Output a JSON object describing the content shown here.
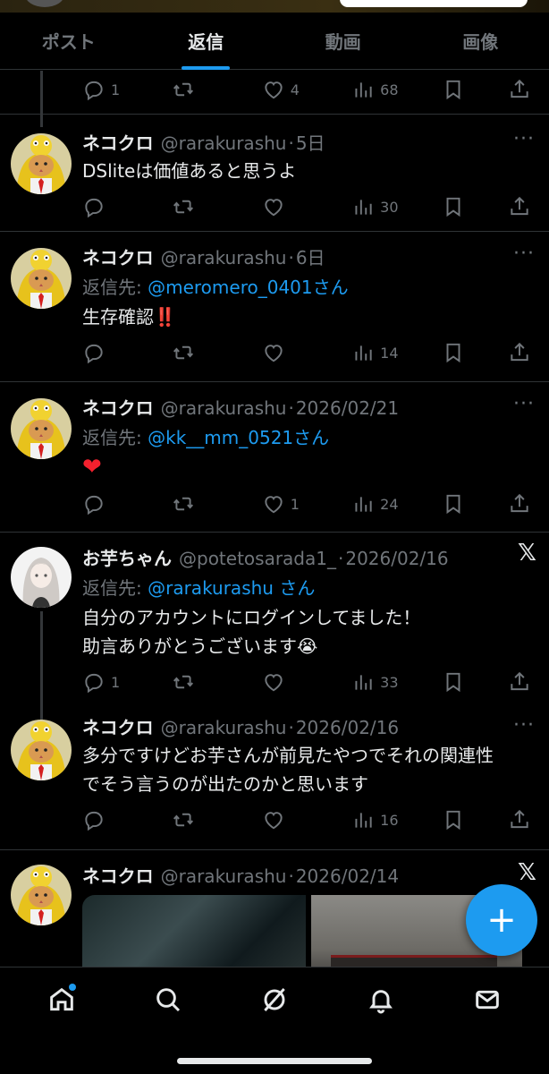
{
  "tabs": [
    {
      "label": "ポスト",
      "active": false
    },
    {
      "label": "返信",
      "active": true
    },
    {
      "label": "動画",
      "active": false
    },
    {
      "label": "画像",
      "active": false
    }
  ],
  "tweets": [
    {
      "partial": true,
      "actions": {
        "reply": "1",
        "retweet": "",
        "like": "4",
        "views": "68"
      }
    },
    {
      "name": "ネコクロ",
      "handle": "@rarakurashu",
      "time": "5日",
      "reply_to": "",
      "body": "DSliteは価値あると思うよ",
      "actions": {
        "reply": "",
        "retweet": "",
        "like": "",
        "views": "30"
      }
    },
    {
      "name": "ネコクロ",
      "handle": "@rarakurashu",
      "time": "6日",
      "reply_prefix": "返信先:",
      "reply_to": "@meromero_0401さん",
      "body": "生存確認",
      "body_emoji": "‼️",
      "actions": {
        "reply": "",
        "retweet": "",
        "like": "",
        "views": "14"
      }
    },
    {
      "name": "ネコクロ",
      "handle": "@rarakurashu",
      "time": "2026/02/21",
      "reply_prefix": "返信先:",
      "reply_to": "@kk__mm_0521さん",
      "body_emoji": "❤",
      "actions": {
        "reply": "",
        "retweet": "",
        "like": "1",
        "views": "24"
      }
    },
    {
      "name": "お芋ちゃん",
      "handle": "@potetosarada1_",
      "time": "2026/02/16",
      "reply_prefix": "返信先:",
      "reply_to": "@rarakurashu さん",
      "body_line1": "自分のアカウントにログインしてました！",
      "body_line2": "助言ありがとうございます",
      "body_emoji": "😭",
      "actions": {
        "reply": "1",
        "retweet": "",
        "like": "",
        "views": "33"
      }
    },
    {
      "name": "ネコクロ",
      "handle": "@rarakurashu",
      "time": "2026/02/16",
      "body_line1": "多分ですけどお芋さんが前見たやつでそれの関連性",
      "body_line2": "でそう言うのが出たのかと思います",
      "actions": {
        "reply": "",
        "retweet": "",
        "like": "",
        "views": "16"
      }
    },
    {
      "name": "ネコクロ",
      "handle": "@rarakurashu",
      "time": "2026/02/14"
    }
  ],
  "sep": "·",
  "more_glyph": "···",
  "x_logo": "𝕏",
  "fab_glyph": "+",
  "colors": {
    "accent": "#1d9bf0",
    "bg": "#000000",
    "muted": "#71767b",
    "text": "#e7e9ea",
    "red": "#f4212e"
  }
}
